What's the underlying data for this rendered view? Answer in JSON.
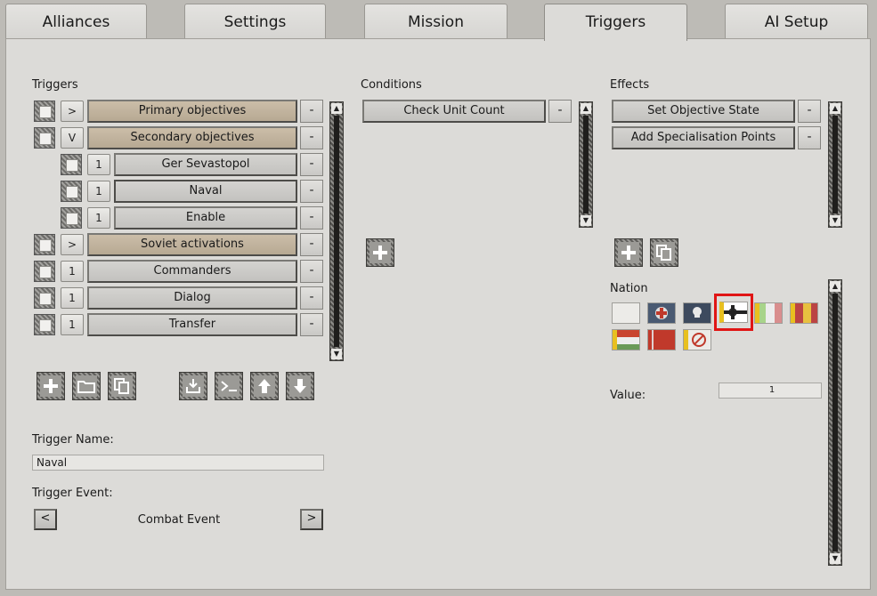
{
  "tabs": [
    {
      "label": "Alliances"
    },
    {
      "label": "Settings"
    },
    {
      "label": "Mission"
    },
    {
      "label": "Triggers"
    },
    {
      "label": "AI Setup"
    }
  ],
  "triggers": {
    "label": "Triggers",
    "rows": [
      {
        "toggle": ">",
        "label": "Primary objectives",
        "minus": "-"
      },
      {
        "toggle": "V",
        "label": "Secondary objectives",
        "minus": "-"
      },
      {
        "toggle": "1",
        "label": "Ger Sevastopol",
        "minus": "-"
      },
      {
        "toggle": "1",
        "label": "Naval",
        "minus": "-"
      },
      {
        "toggle": "1",
        "label": "Enable",
        "minus": "-"
      },
      {
        "toggle": ">",
        "label": "Soviet activations",
        "minus": "-"
      },
      {
        "toggle": "1",
        "label": "Commanders",
        "minus": "-"
      },
      {
        "toggle": "1",
        "label": "Dialog",
        "minus": "-"
      },
      {
        "toggle": "1",
        "label": "Transfer",
        "minus": "-"
      }
    ]
  },
  "conditions": {
    "label": "Conditions",
    "items": [
      {
        "label": "Check Unit Count",
        "minus": "-"
      }
    ]
  },
  "effects": {
    "label": "Effects",
    "items": [
      {
        "label": "Set Objective State",
        "minus": "-"
      },
      {
        "label": "Add Specialisation Points",
        "minus": "-"
      }
    ]
  },
  "nation": {
    "label": "Nation"
  },
  "value": {
    "label": "Value:",
    "value": "1"
  },
  "trigger_name": {
    "label": "Trigger Name:",
    "value": "Naval"
  },
  "trigger_event": {
    "label": "Trigger Event:",
    "value": "Combat Event",
    "prev": "<",
    "next": ">"
  },
  "scroll": {
    "up": "▲",
    "down": "▼"
  }
}
